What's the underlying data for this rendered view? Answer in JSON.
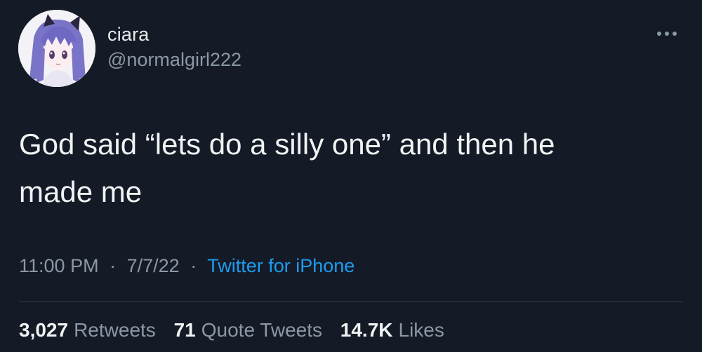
{
  "user": {
    "display_name": "ciara",
    "handle": "@normalgirl222",
    "avatar_icon": "anime-girl-avatar"
  },
  "tweet": {
    "text": "God said “lets do a silly one” and then he\nmade me"
  },
  "meta": {
    "time": "11:00 PM",
    "separator": "·",
    "date": "7/7/22",
    "source": "Twitter for iPhone"
  },
  "stats": {
    "retweets_count": "3,027",
    "retweets_label": "Retweets",
    "quotes_count": "71",
    "quotes_label": "Quote Tweets",
    "likes_count": "14.7K",
    "likes_label": "Likes"
  },
  "colors": {
    "background": "#141b26",
    "text_primary": "#e7e9ea",
    "text_secondary": "#8b98a5",
    "link": "#1d9bf0"
  },
  "icons": {
    "more": "more-options-icon"
  }
}
